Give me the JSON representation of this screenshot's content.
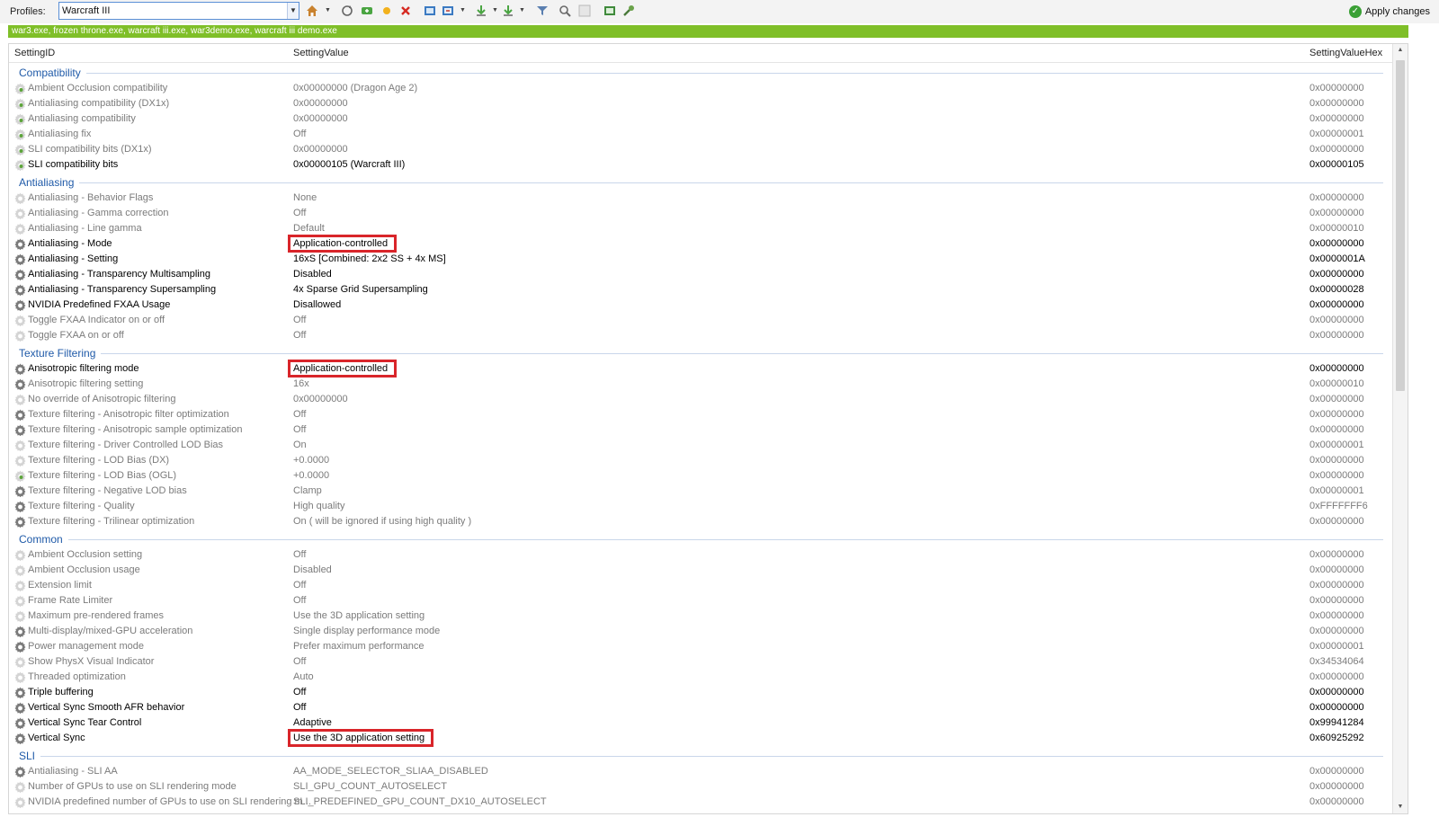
{
  "toolbar": {
    "profiles_label": "Profiles:",
    "profile_value": "Warcraft III",
    "apply_label": "Apply changes"
  },
  "exe_list": "war3.exe, frozen throne.exe, warcraft iii.exe, war3demo.exe, warcraft iii demo.exe",
  "columns": {
    "setting_id": "SettingID",
    "setting_value": "SettingValue",
    "setting_value_hex": "SettingValueHex"
  },
  "groups": [
    {
      "name": "Compatibility",
      "rows": [
        {
          "id": "Ambient Occlusion compatibility",
          "value": "0x00000000 (Dragon Age 2)",
          "hex": "0x00000000",
          "style": "dim",
          "icon": "green"
        },
        {
          "id": "Antialiasing compatibility (DX1x)",
          "value": "0x00000000",
          "hex": "0x00000000",
          "style": "dim",
          "icon": "green"
        },
        {
          "id": "Antialiasing compatibility",
          "value": "0x00000000",
          "hex": "0x00000000",
          "style": "dim",
          "icon": "green"
        },
        {
          "id": "Antialiasing fix",
          "value": "Off",
          "hex": "0x00000001",
          "style": "dim",
          "icon": "green"
        },
        {
          "id": "SLI compatibility bits (DX1x)",
          "value": "0x00000000",
          "hex": "0x00000000",
          "style": "dim",
          "icon": "green"
        },
        {
          "id": "SLI compatibility bits",
          "value": "0x00000105 (Warcraft III)",
          "hex": "0x00000105",
          "style": "bold",
          "icon": "green"
        }
      ]
    },
    {
      "name": "Antialiasing",
      "rows": [
        {
          "id": "Antialiasing - Behavior Flags",
          "value": "None",
          "hex": "0x00000000",
          "style": "dim",
          "icon": "dim"
        },
        {
          "id": "Antialiasing - Gamma correction",
          "value": "Off",
          "hex": "0x00000000",
          "style": "dim",
          "icon": "dim"
        },
        {
          "id": "Antialiasing - Line gamma",
          "value": "Default",
          "hex": "0x00000010",
          "style": "dim",
          "icon": "dim"
        },
        {
          "id": "Antialiasing - Mode",
          "value": "Application-controlled",
          "hex": "0x00000000",
          "style": "bold",
          "icon": "gear",
          "highlight": true
        },
        {
          "id": "Antialiasing - Setting",
          "value": "16xS [Combined: 2x2 SS + 4x MS]",
          "hex": "0x0000001A",
          "style": "bold",
          "icon": "gear"
        },
        {
          "id": "Antialiasing - Transparency Multisampling",
          "value": "Disabled",
          "hex": "0x00000000",
          "style": "bold",
          "icon": "gear"
        },
        {
          "id": "Antialiasing - Transparency Supersampling",
          "value": "4x Sparse Grid Supersampling",
          "hex": "0x00000028",
          "style": "bold",
          "icon": "gear"
        },
        {
          "id": "NVIDIA Predefined FXAA Usage",
          "value": "Disallowed",
          "hex": "0x00000000",
          "style": "bold",
          "icon": "gear"
        },
        {
          "id": "Toggle FXAA Indicator on or off",
          "value": "Off",
          "hex": "0x00000000",
          "style": "dim",
          "icon": "dim"
        },
        {
          "id": "Toggle FXAA on or off",
          "value": "Off",
          "hex": "0x00000000",
          "style": "dim",
          "icon": "dim"
        }
      ]
    },
    {
      "name": "Texture Filtering",
      "rows": [
        {
          "id": "Anisotropic filtering mode",
          "value": "Application-controlled",
          "hex": "0x00000000",
          "style": "bold",
          "icon": "gear",
          "highlight": true
        },
        {
          "id": "Anisotropic filtering setting",
          "value": "16x",
          "hex": "0x00000010",
          "style": "dim",
          "icon": "gear"
        },
        {
          "id": "No override of Anisotropic filtering",
          "value": "0x00000000",
          "hex": "0x00000000",
          "style": "dim",
          "icon": "dim"
        },
        {
          "id": "Texture filtering - Anisotropic filter optimization",
          "value": "Off",
          "hex": "0x00000000",
          "style": "dim",
          "icon": "gear"
        },
        {
          "id": "Texture filtering - Anisotropic sample optimization",
          "value": "Off",
          "hex": "0x00000000",
          "style": "dim",
          "icon": "gear"
        },
        {
          "id": "Texture filtering - Driver Controlled LOD Bias",
          "value": "On",
          "hex": "0x00000001",
          "style": "dim",
          "icon": "dim"
        },
        {
          "id": "Texture filtering - LOD Bias (DX)",
          "value": "+0.0000",
          "hex": "0x00000000",
          "style": "dim",
          "icon": "dim"
        },
        {
          "id": "Texture filtering - LOD Bias (OGL)",
          "value": "+0.0000",
          "hex": "0x00000000",
          "style": "dim",
          "icon": "green"
        },
        {
          "id": "Texture filtering - Negative LOD bias",
          "value": "Clamp",
          "hex": "0x00000001",
          "style": "dim",
          "icon": "gear"
        },
        {
          "id": "Texture filtering - Quality",
          "value": "High quality",
          "hex": "0xFFFFFFF6",
          "style": "dim",
          "icon": "gear"
        },
        {
          "id": "Texture filtering - Trilinear optimization",
          "value": "On ( will be ignored if using high quality )",
          "hex": "0x00000000",
          "style": "dim",
          "icon": "gear"
        }
      ]
    },
    {
      "name": "Common",
      "rows": [
        {
          "id": "Ambient Occlusion setting",
          "value": "Off",
          "hex": "0x00000000",
          "style": "dim",
          "icon": "dim"
        },
        {
          "id": "Ambient Occlusion usage",
          "value": "Disabled",
          "hex": "0x00000000",
          "style": "dim",
          "icon": "dim"
        },
        {
          "id": "Extension limit",
          "value": "Off",
          "hex": "0x00000000",
          "style": "dim",
          "icon": "dim"
        },
        {
          "id": "Frame Rate Limiter",
          "value": "Off",
          "hex": "0x00000000",
          "style": "dim",
          "icon": "dim"
        },
        {
          "id": "Maximum pre-rendered frames",
          "value": "Use the 3D application setting",
          "hex": "0x00000000",
          "style": "dim",
          "icon": "dim"
        },
        {
          "id": "Multi-display/mixed-GPU acceleration",
          "value": "Single display performance mode",
          "hex": "0x00000000",
          "style": "dim",
          "icon": "gear"
        },
        {
          "id": "Power management mode",
          "value": "Prefer maximum performance",
          "hex": "0x00000001",
          "style": "dim",
          "icon": "gear"
        },
        {
          "id": "Show PhysX Visual Indicator",
          "value": "Off",
          "hex": "0x34534064",
          "style": "dim",
          "icon": "dim"
        },
        {
          "id": "Threaded optimization",
          "value": "Auto",
          "hex": "0x00000000",
          "style": "dim",
          "icon": "dim"
        },
        {
          "id": "Triple buffering",
          "value": "Off",
          "hex": "0x00000000",
          "style": "bold",
          "icon": "gear"
        },
        {
          "id": "Vertical Sync Smooth AFR behavior",
          "value": "Off",
          "hex": "0x00000000",
          "style": "bold",
          "icon": "gear"
        },
        {
          "id": "Vertical Sync Tear Control",
          "value": "Adaptive",
          "hex": "0x99941284",
          "style": "bold",
          "icon": "gear"
        },
        {
          "id": "Vertical Sync",
          "value": "Use the 3D application setting",
          "hex": "0x60925292",
          "style": "bold",
          "icon": "gear",
          "highlight": true
        }
      ]
    },
    {
      "name": "SLI",
      "rows": [
        {
          "id": "Antialiasing - SLI AA",
          "value": "AA_MODE_SELECTOR_SLIAA_DISABLED",
          "hex": "0x00000000",
          "style": "dim",
          "icon": "gear"
        },
        {
          "id": "Number of GPUs to use on SLI rendering mode",
          "value": "SLI_GPU_COUNT_AUTOSELECT",
          "hex": "0x00000000",
          "style": "dim",
          "icon": "dim"
        },
        {
          "id": "NVIDIA predefined number of GPUs to use on SLI rendering m...",
          "value": "SLI_PREDEFINED_GPU_COUNT_DX10_AUTOSELECT",
          "hex": "0x00000000",
          "style": "dim",
          "icon": "dim"
        }
      ]
    }
  ],
  "icons": {
    "home": "home-icon",
    "refresh": "refresh-icon",
    "add": "add-profile-icon",
    "star": "star-icon",
    "delete": "delete-icon",
    "export": "export-icon",
    "import": "import-icon",
    "filter": "filter-icon",
    "scan": "scan-icon",
    "settings": "settings-icon"
  },
  "colors": {
    "exebar": "#7fbf28",
    "highlight": "#d9252a",
    "group_text": "#1f5aa8",
    "apply_check": "#3aa035"
  }
}
